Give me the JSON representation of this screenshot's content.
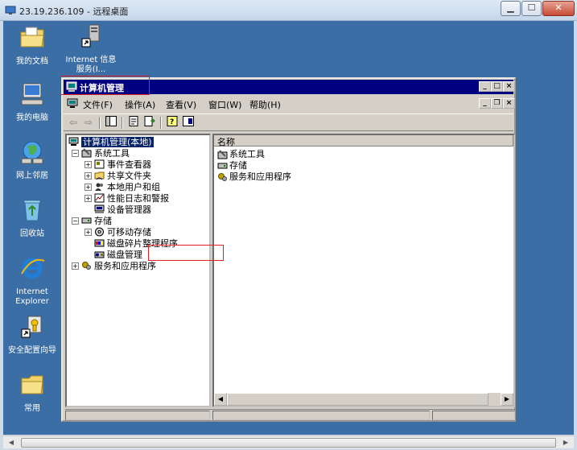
{
  "rdp": {
    "title": "23.19.236.109 - 远程桌面",
    "minimize": "▁",
    "maximize": "☐",
    "close": "✕"
  },
  "desktop_icons": [
    {
      "label": "我的文档"
    },
    {
      "label": "Internet 信息服务(I..."
    },
    {
      "label": "我的电脑"
    },
    {
      "label": "网上邻居"
    },
    {
      "label": "回收站"
    },
    {
      "label": "Internet Explorer"
    },
    {
      "label": "安全配置向导"
    },
    {
      "label": "常用"
    }
  ],
  "cm": {
    "title": "计算机管理",
    "menu": [
      "文件(F)",
      "操作(A)",
      "查看(V)",
      "窗口(W)",
      "帮助(H)"
    ],
    "tree": {
      "root": "计算机管理(本地)",
      "system_tools": "系统工具",
      "event_viewer": "事件查看器",
      "shared_folders": "共享文件夹",
      "local_users": "本地用户和组",
      "perf_logs": "性能日志和警报",
      "device_manager": "设备管理器",
      "storage": "存储",
      "removable": "可移动存储",
      "defrag": "磁盘碎片整理程序",
      "disk_mgmt": "磁盘管理",
      "services": "服务和应用程序"
    },
    "list": {
      "col_name": "名称",
      "rows": [
        "系统工具",
        "存储",
        "服务和应用程序"
      ]
    }
  },
  "colors": {
    "desktop": "#3a6ea5",
    "titlebar": "#000080",
    "highlight": "#e02020"
  }
}
